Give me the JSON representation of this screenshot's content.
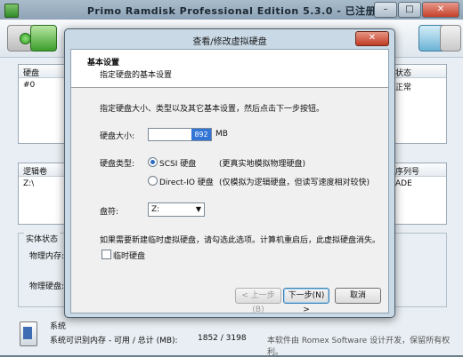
{
  "main": {
    "title": "Primo Ramdisk Professional Edition 5.3.0 - 已注册",
    "disk_headers": [
      "硬盘",
      "状态"
    ],
    "disk_rows": [
      {
        "id": "#0",
        "status": "正常"
      }
    ],
    "volume_headers": [
      "逻辑卷",
      "序列号"
    ],
    "volume_rows": [
      {
        "name": "Z:\\",
        "serial": "ADE"
      }
    ],
    "state_title": "实体状态",
    "physical_mem_label": "物理内存:",
    "physical_disk_label": "物理硬盘:",
    "status_line1": "系统",
    "status_line2_label": "系统可识别内存 - 可用 / 总计 (MB):",
    "status_line2_value": "1852 / 3198",
    "copyright": "本软件由 Romex Software 设计开发，保留所有权利。"
  },
  "dialog": {
    "title": "查看/修改虚拟硬盘",
    "close_label": "✕",
    "header_title": "基本设置",
    "header_subtitle": "指定硬盘的基本设置",
    "instruction": "指定硬盘大小、类型以及其它基本设置，然后点击下一步按钮。",
    "size_label": "硬盘大小:",
    "size_value": "892",
    "size_unit": "MB",
    "type_label": "硬盘类型:",
    "option_scsi": "SCSI 硬盘",
    "option_scsi_desc": "(更真实地模拟物理硬盘)",
    "option_directio": "Direct-IO 硬盘",
    "option_directio_desc": "(仅模拟为逻辑硬盘，但读写速度相对较快)",
    "drive_label": "盘符:",
    "drive_value": "Z:",
    "temp_note": "如果需要新建临时虚拟硬盘，请勾选此选项。计算机重启后，此虚拟硬盘消失。",
    "temp_checkbox_label": "临时硬盘",
    "temp_checked": false,
    "selected_type": "scsi",
    "btn_back": "< 上一步(B)",
    "btn_next": "下一步(N) >",
    "btn_cancel": "取消"
  }
}
